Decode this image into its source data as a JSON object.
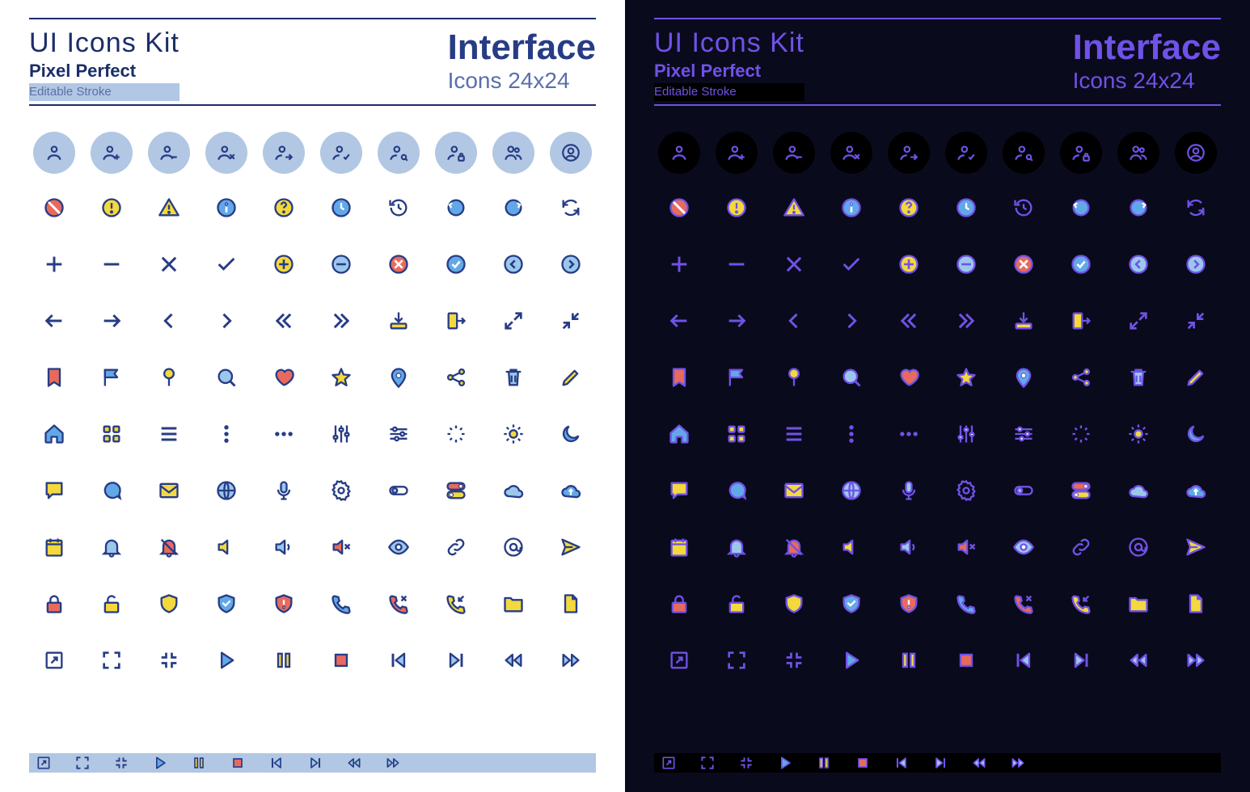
{
  "header": {
    "title": "UI Icons Kit",
    "sub1": "Pixel Perfect",
    "sub2": "Editable Stroke",
    "big": "Interface",
    "size": "Icons 24x24"
  },
  "colors": {
    "light_bg": "#ffffff",
    "dark_bg": "#0a0a1d",
    "light_accent": "#273c85",
    "dark_accent": "#6f52e6",
    "light_strip": "#b1c7e3",
    "yellow": "#f3d83e",
    "red": "#e86a5e",
    "blue": "#62a8e8"
  },
  "icons": [
    [
      "user",
      "user-add",
      "user-remove",
      "user-x",
      "user-arrow",
      "user-check",
      "user-search",
      "user-lock",
      "users",
      "user-circle"
    ],
    [
      "no-entry",
      "alert-circle",
      "alert-triangle",
      "info",
      "question",
      "clock",
      "history",
      "refresh-ccw",
      "refresh-cw",
      "sync"
    ],
    [
      "plus",
      "minus",
      "x",
      "check",
      "plus-circle",
      "minus-circle",
      "x-circle",
      "check-circle",
      "chevron-left-circle",
      "chevron-right-circle"
    ],
    [
      "arrow-left",
      "arrow-right",
      "chevron-left",
      "chevron-right",
      "chevrons-left",
      "chevrons-right",
      "download",
      "exit",
      "expand",
      "shrink"
    ],
    [
      "bookmark",
      "flag",
      "pin",
      "search",
      "heart",
      "star",
      "map-pin",
      "share",
      "trash",
      "edit"
    ],
    [
      "home",
      "grid",
      "menu",
      "more-vertical",
      "more-horizontal",
      "sliders-v",
      "sliders-h",
      "loading",
      "sun",
      "moon"
    ],
    [
      "message",
      "chat",
      "mail",
      "globe",
      "mic",
      "settings",
      "toggle-off",
      "toggle-on",
      "cloud",
      "cloud-up"
    ],
    [
      "calendar",
      "bell",
      "bell-off",
      "volume-0",
      "volume-1",
      "volume-x",
      "eye",
      "link",
      "at",
      "send"
    ],
    [
      "lock",
      "unlock",
      "shield",
      "shield-check",
      "shield-alert",
      "phone",
      "phone-x",
      "phone-in",
      "folder",
      "file"
    ],
    [
      "external",
      "fullscreen",
      "exit-fullscreen",
      "play",
      "pause",
      "stop",
      "skip-back",
      "skip-forward",
      "rewind",
      "fast-forward"
    ]
  ],
  "strip": [
    "external",
    "fullscreen",
    "exit-fullscreen",
    "play",
    "pause",
    "stop",
    "skip-back",
    "skip-forward",
    "rewind",
    "fast-forward"
  ]
}
